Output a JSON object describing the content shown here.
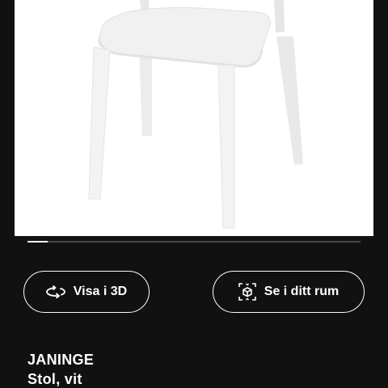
{
  "gallery": {
    "image_alt": "JANINGE Stol, vit",
    "progress": 0.06
  },
  "actions": {
    "view_3d_label": "Visa i 3D",
    "view_3d_icon": "rotate-3d-icon",
    "view_in_room_label": "Se i ditt rum",
    "view_in_room_icon": "ar-cube-icon"
  },
  "product": {
    "name": "JANINGE",
    "description": "Stol, vit"
  },
  "colors": {
    "background": "#111111",
    "image_background": "#ffffff",
    "text": "#ffffff"
  }
}
